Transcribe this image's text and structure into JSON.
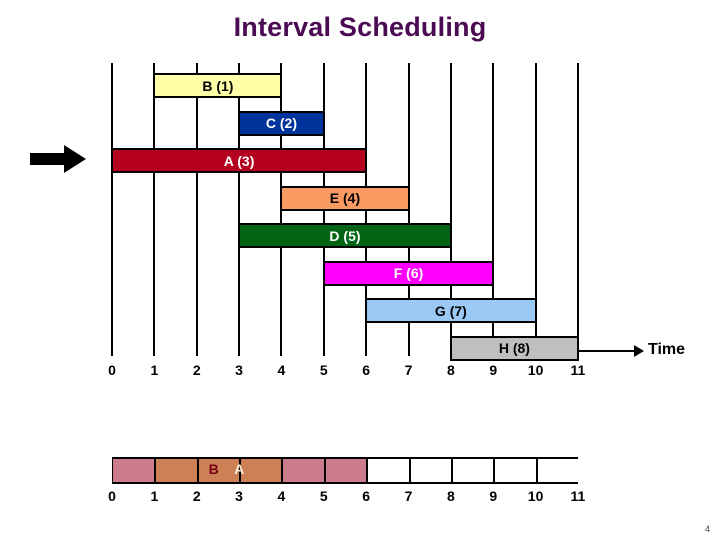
{
  "title": "Interval Scheduling",
  "page_number": "4",
  "axis": {
    "label": "Time",
    "ticks": [
      "0",
      "1",
      "2",
      "3",
      "4",
      "5",
      "6",
      "7",
      "8",
      "9",
      "10",
      "11"
    ],
    "min": 0,
    "max": 11
  },
  "icons": {
    "pointer": "right-arrow-icon",
    "axis_arrow": "right-arrow-icon"
  },
  "chart_data": {
    "type": "bar",
    "orientation": "horizontal",
    "title": "Interval Scheduling",
    "xlabel": "Time",
    "ylabel": "",
    "xlim": [
      0,
      11
    ],
    "grid": true,
    "legend": "none",
    "categories": [
      "B (1)",
      "C (2)",
      "A (3)",
      "E (4)",
      "D (5)",
      "F (6)",
      "G (7)",
      "H (8)"
    ],
    "intervals": [
      {
        "label": "B (1)",
        "name": "B",
        "index": 1,
        "start": 1,
        "finish": 4,
        "color": "#ffffa8",
        "text_color": "#000000",
        "row": 0
      },
      {
        "label": "C (2)",
        "name": "C",
        "index": 2,
        "start": 3,
        "finish": 5,
        "color": "#00339b",
        "text_color": "#ffffff",
        "row": 1
      },
      {
        "label": "A (3)",
        "name": "A",
        "index": 3,
        "start": 0,
        "finish": 6,
        "color": "#b5001f",
        "text_color": "#ffffff",
        "row": 2
      },
      {
        "label": "E (4)",
        "name": "E",
        "index": 4,
        "start": 4,
        "finish": 7,
        "color": "#fa9a63",
        "text_color": "#000000",
        "row": 3
      },
      {
        "label": "D (5)",
        "name": "D",
        "index": 5,
        "start": 3,
        "finish": 8,
        "color": "#006414",
        "text_color": "#ffffff",
        "row": 4
      },
      {
        "label": "F (6)",
        "name": "F",
        "index": 6,
        "start": 5,
        "finish": 9,
        "color": "#ff00ff",
        "text_color": "#ffffff",
        "row": 5
      },
      {
        "label": "G (7)",
        "name": "G",
        "index": 7,
        "start": 6,
        "finish": 10,
        "color": "#9bc9f5",
        "text_color": "#000000",
        "row": 6
      },
      {
        "label": "H (8)",
        "name": "H",
        "index": 8,
        "start": 8,
        "finish": 11,
        "color": "#bfbfbf",
        "text_color": "#000000",
        "row": 7
      }
    ]
  },
  "schedule": {
    "segments": [
      {
        "start": 0,
        "finish": 1,
        "color": "#cd7c8e",
        "label": ""
      },
      {
        "start": 1,
        "finish": 4,
        "color": "#cd7f55",
        "label": ""
      },
      {
        "start": 4,
        "finish": 5,
        "color": "#cd7c8e",
        "label": ""
      },
      {
        "start": 5,
        "finish": 6,
        "color": "#cd7c8e",
        "label": ""
      },
      {
        "start": 6,
        "finish": 7,
        "color": "#ffffff",
        "label": ""
      },
      {
        "start": 7,
        "finish": 8,
        "color": "#ffffff",
        "label": ""
      },
      {
        "start": 8,
        "finish": 9,
        "color": "#ffffff",
        "label": ""
      },
      {
        "start": 9,
        "finish": 10,
        "color": "#ffffff",
        "label": ""
      },
      {
        "start": 10,
        "finish": 11,
        "color": "#ffffff",
        "label": ""
      }
    ],
    "annotations": [
      {
        "text": "B",
        "position": 2.4,
        "color": "#7c0014"
      },
      {
        "text": "A",
        "position": 3.0,
        "color": "#ffeedd"
      }
    ],
    "ticks": [
      "0",
      "1",
      "2",
      "3",
      "4",
      "5",
      "6",
      "7",
      "8",
      "9",
      "10",
      "11"
    ]
  }
}
